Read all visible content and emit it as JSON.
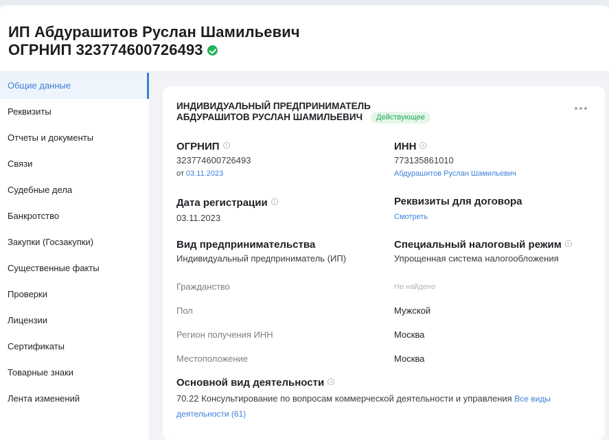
{
  "header": {
    "title_line1": "ИП Абдурашитов Руслан Шамильевич",
    "title_line2": "ОГРНИП 323774600726493"
  },
  "sidebar": {
    "items": [
      {
        "label": "Общие данные",
        "active": true
      },
      {
        "label": "Реквизиты"
      },
      {
        "label": "Отчеты и документы"
      },
      {
        "label": "Связи"
      },
      {
        "label": "Судебные дела"
      },
      {
        "label": "Банкротство"
      },
      {
        "label": "Закупки (Госзакупки)"
      },
      {
        "label": "Существенные факты"
      },
      {
        "label": "Проверки"
      },
      {
        "label": "Лицензии"
      },
      {
        "label": "Сертификаты"
      },
      {
        "label": "Товарные знаки"
      },
      {
        "label": "Лента изменений"
      }
    ]
  },
  "card": {
    "org_name_line1": "ИНДИВИДУАЛЬНЫЙ ПРЕДПРИНИМАТЕЛЬ",
    "org_name_line2": "АБДУРАШИТОВ РУСЛАН ШАМИЛЬЕВИЧ",
    "status": "Действующее",
    "ogrnip": {
      "label": "ОГРНИП",
      "value": "323774600726493",
      "date_prefix": "от",
      "date": "03.11.2023"
    },
    "inn": {
      "label": "ИНН",
      "value": "773135861010",
      "owner_link": "Абдурашитов Руслан Шамильевич"
    },
    "registration": {
      "label": "Дата регистрации",
      "value": "03.11.2023"
    },
    "contract_details": {
      "label": "Реквизиты для договора",
      "link": "Смотреть"
    },
    "business_type": {
      "label": "Вид предпринимательства",
      "value": "Индивидуальный предприниматель (ИП)"
    },
    "tax_regime": {
      "label": "Специальный налоговый режим",
      "value": "Упрощенная система налогообложения"
    },
    "citizenship": {
      "label": "Гражданство",
      "value": "Не найдено"
    },
    "gender": {
      "label": "Пол",
      "value": "Мужской"
    },
    "inn_region": {
      "label": "Регион получения ИНН",
      "value": "Москва"
    },
    "location": {
      "label": "Местоположение",
      "value": "Москва"
    },
    "main_activity": {
      "label": "Основной вид деятельности",
      "value": "70.22 Консультирование по вопросам коммерческой деятельности и управления",
      "all_link": "Все виды деятельности (61)"
    }
  },
  "colors": {
    "accent": "#3d7fd9",
    "status_green": "#1faa57",
    "check_green": "#21b15a"
  }
}
